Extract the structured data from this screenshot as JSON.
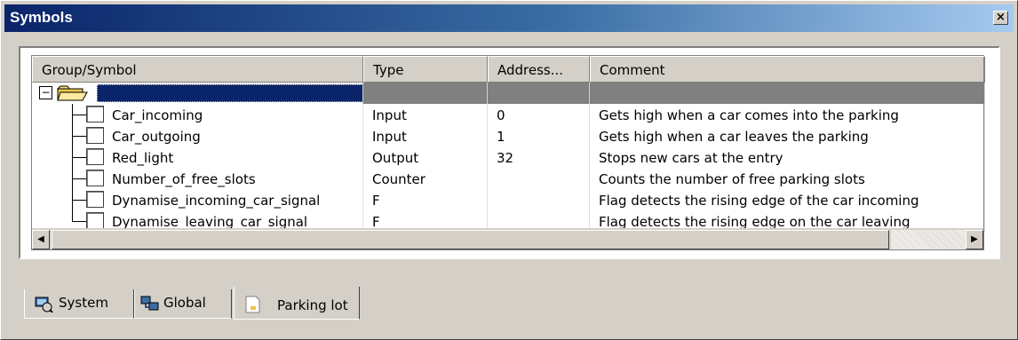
{
  "window": {
    "title": "Symbols",
    "close_glyph": "×"
  },
  "table": {
    "columns": [
      "Group/Symbol",
      "Type",
      "Address...",
      "Comment"
    ],
    "group_row": {
      "expander": "−",
      "icon": "folder-open-icon",
      "label": ""
    },
    "rows": [
      {
        "symbol": "Car_incoming",
        "type": "Input",
        "address": "0",
        "comment": "Gets high when a car comes into the parking"
      },
      {
        "symbol": "Car_outgoing",
        "type": "Input",
        "address": "1",
        "comment": "Gets high when a car leaves the parking"
      },
      {
        "symbol": "Red_light",
        "type": "Output",
        "address": "32",
        "comment": "Stops new cars at the entry"
      },
      {
        "symbol": "Number_of_free_slots",
        "type": "Counter",
        "address": "",
        "comment": "Counts the number of free parking slots"
      },
      {
        "symbol": "Dynamise_incoming_car_signal",
        "type": "F",
        "address": "",
        "comment": "Flag detects the rising edge of the  car incoming"
      },
      {
        "symbol": "Dynamise_leaving_car_signal",
        "type": "F",
        "address": "",
        "comment": "Flag detects the rising edge on the car leaving"
      }
    ]
  },
  "scrollbar": {
    "left_arrow": "◀",
    "right_arrow": "▶"
  },
  "tabs": [
    {
      "label": "System",
      "icon": "system-icon",
      "active": false
    },
    {
      "label": "Global",
      "icon": "global-icon",
      "active": false
    },
    {
      "label": "Parking lot",
      "icon": "document-icon",
      "active": true
    }
  ],
  "colors": {
    "title_start": "#0a246a",
    "title_end": "#a6caf0",
    "selection": "#0a246a",
    "group_row_bg": "#808080"
  }
}
